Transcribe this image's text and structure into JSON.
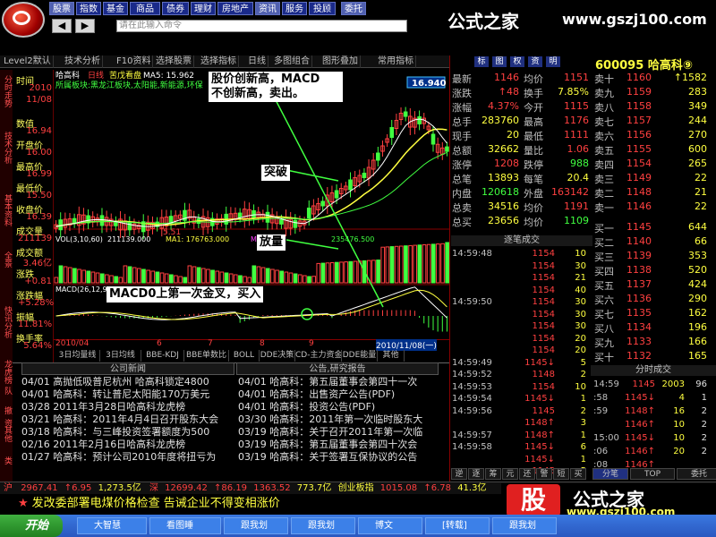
{
  "menu": [
    "股票",
    "指数",
    "基金",
    "商品",
    "债券",
    "理财",
    "房地产",
    "资讯",
    "服务",
    "投顾",
    "委托"
  ],
  "command_placeholder": "请在此输入命令",
  "brand": {
    "title": "公式之家",
    "url": "www.gszj100.com",
    "mark": "股"
  },
  "toolbar": [
    "Level2默认",
    "技术分析",
    "F10资料",
    "选择股票",
    "选择指标",
    "日线",
    "多图组合",
    "图形叠加",
    "常用指标"
  ],
  "chart_header": {
    "name": "哈高科",
    "period": "日线",
    "label": "苦戊看盘",
    "ma_text": "MA5: 15.962",
    "high_price": "16.940",
    "low_price": "5.51"
  },
  "chart_info": {
    "sub1": "所属板块:黑龙江板块,太阳能,新能源,环保",
    "vol_label": "VOL(3,10,60)",
    "vol_val": "211139.000",
    "vol_ma1": "MA1: 176763.000",
    "vol_ma2": "MA2",
    "vol_ma3": "235476.500",
    "macd_label": "MACD(26,12,9)"
  },
  "left_data": [
    {
      "label": "时间",
      "value": "2010"
    },
    {
      "label": "",
      "value": "11/08"
    },
    {
      "label": "数值",
      "value": "16.94"
    },
    {
      "label": "开盘价",
      "value": "16.00"
    },
    {
      "label": "最高价",
      "value": "16.99"
    },
    {
      "label": "最低价",
      "value": "15.50"
    },
    {
      "label": "收盘价",
      "value": "16.39"
    },
    {
      "label": "成交量",
      "value": "211139"
    },
    {
      "label": "成交额",
      "value": "3.46亿"
    },
    {
      "label": "涨跌",
      "value": "+0.81"
    },
    {
      "label": "涨跌幅",
      "value": "+5.28%"
    },
    {
      "label": "振幅",
      "value": "11.81%"
    },
    {
      "label": "换手率",
      "value": "5.64%"
    }
  ],
  "left_tabs": [
    "分时走势",
    "技术分析",
    "基本资料",
    "全景",
    "快讯分析",
    "龙虎榜",
    "队",
    "撤",
    "资",
    "其他",
    "类"
  ],
  "date_ticks": [
    "2010/04",
    "6",
    "7",
    "8",
    "9",
    "2010/11/08(一)"
  ],
  "bottom_tabs": [
    "3日均量线",
    "3日均线",
    "BBE-KDJ",
    "BBE单数比",
    "BOLL",
    "DDE决策",
    "CD-主力资金",
    "DDE能量",
    "其他"
  ],
  "annotations": [
    {
      "text": "股价创新高，MACD\n不创新高，卖出。"
    },
    {
      "text": "突破"
    },
    {
      "text": "放量"
    },
    {
      "text": "MACD0上第一次金叉，买入"
    }
  ],
  "news_left_title": "公司新闻",
  "news_right_title": "公告,研究报告",
  "news_left": [
    "04/01 高抛低吸普尼杭州 哈高科锁定4800",
    "04/01 哈高科：转让普尼太阳能170万美元",
    "03/28 2011年3月28日哈高科龙虎榜",
    "03/21 哈高科：2011年4月4日召开股东大会",
    "03/18 哈高科：与三峰投资签署额度为500",
    "02/16 2011年2月16日哈高科龙虎榜",
    "01/27 哈高科：预计公司2010年度将扭亏为"
  ],
  "news_right": [
    "04/01 哈高科：第五届董事会第四十一次",
    "04/01 哈高科：出售资产公告(PDF)",
    "04/01 哈高科：投资公告(PDF)",
    "03/30 哈高科：2011年第一次临时股东大",
    "03/19 哈高科：关于召开2011年第一次临",
    "03/19 哈高科：第五届董事会第四十次会",
    "03/19 哈高科：关于签署互保协议的公告"
  ],
  "quote_tabs": [
    "标",
    "图",
    "权",
    "资",
    "明"
  ],
  "stock": {
    "code": "600095",
    "name": "哈高科",
    "suffix": "⑨"
  },
  "quote_left": [
    {
      "label": "最新",
      "value": "1146",
      "color": "red",
      "label2": "均价",
      "value2": "1151",
      "color2": "red"
    },
    {
      "label": "涨跌",
      "value": "↑48",
      "color": "red",
      "label2": "换手",
      "value2": "7.85%",
      "color2": "yel"
    },
    {
      "label": "涨幅",
      "value": "4.37%",
      "color": "red",
      "label2": "今开",
      "value2": "1115",
      "color2": "red"
    },
    {
      "label": "总手",
      "value": "283760",
      "color": "yel",
      "label2": "最高",
      "value2": "1176",
      "color2": "red"
    },
    {
      "label": "现手",
      "value": "20",
      "color": "yel",
      "label2": "最低",
      "value2": "1111",
      "color2": "red"
    },
    {
      "label": "总额",
      "value": "32662",
      "color": "yel",
      "label2": "量比",
      "value2": "1.06",
      "color2": "red"
    },
    {
      "label": "涨停",
      "value": "1208",
      "color": "red",
      "label2": "跌停",
      "value2": "988",
      "color2": "grn"
    },
    {
      "label": "总笔",
      "value": "13893",
      "color": "yel",
      "label2": "每笔",
      "value2": "20.4",
      "color2": "yel"
    },
    {
      "label": "内盘",
      "value": "120618",
      "color": "grn",
      "label2": "外盘",
      "value2": "163142",
      "color2": "red"
    },
    {
      "label": "总卖",
      "value": "34516",
      "color": "yel",
      "label2": "均价",
      "value2": "1191",
      "color2": "red"
    },
    {
      "label": "总买",
      "value": "23656",
      "color": "yel",
      "label2": "均价",
      "value2": "1109",
      "color2": "grn"
    }
  ],
  "sell_orders": [
    {
      "label": "卖十",
      "price": "1160",
      "vol": "↑1582"
    },
    {
      "label": "卖九",
      "price": "1159",
      "vol": "283"
    },
    {
      "label": "卖八",
      "price": "1158",
      "vol": "349"
    },
    {
      "label": "卖七",
      "price": "1157",
      "vol": "244"
    },
    {
      "label": "卖六",
      "price": "1156",
      "vol": "270"
    },
    {
      "label": "卖五",
      "price": "1155",
      "vol": "600"
    },
    {
      "label": "卖四",
      "price": "1154",
      "vol": "265"
    },
    {
      "label": "卖三",
      "price": "1149",
      "vol": "22"
    },
    {
      "label": "卖二",
      "price": "1148",
      "vol": "21"
    },
    {
      "label": "卖一",
      "price": "1146",
      "vol": "22"
    }
  ],
  "buy_orders": [
    {
      "label": "买一",
      "price": "1145",
      "vol": "644"
    },
    {
      "label": "买二",
      "price": "1140",
      "vol": "66"
    },
    {
      "label": "买三",
      "price": "1139",
      "vol": "353"
    },
    {
      "label": "买四",
      "price": "1138",
      "vol": "520"
    },
    {
      "label": "买五",
      "price": "1137",
      "vol": "424"
    },
    {
      "label": "买六",
      "price": "1136",
      "vol": "290"
    },
    {
      "label": "买七",
      "price": "1135",
      "vol": "162"
    },
    {
      "label": "买八",
      "price": "1134",
      "vol": "196"
    },
    {
      "label": "买九",
      "price": "1133",
      "vol": "166"
    },
    {
      "label": "买十",
      "price": "1132",
      "vol": "165"
    }
  ],
  "ticks_title": "逐笔成交",
  "ticks": [
    {
      "time": "14:59:48",
      "price": "1154",
      "vol": "10"
    },
    {
      "time": "",
      "price": "1154",
      "vol": "30"
    },
    {
      "time": "",
      "price": "1154",
      "vol": "21"
    },
    {
      "time": "",
      "price": "1154",
      "vol": "40"
    },
    {
      "time": "14:59:50",
      "price": "1154",
      "vol": "30"
    },
    {
      "time": "",
      "price": "1154",
      "vol": "30"
    },
    {
      "time": "",
      "price": "1154",
      "vol": "30"
    },
    {
      "time": "",
      "price": "1154",
      "vol": "20"
    },
    {
      "time": "",
      "price": "1154",
      "vol": "20"
    },
    {
      "time": "14:59:49",
      "price": "1145↓",
      "vol": "5"
    },
    {
      "time": "14:59:52",
      "price": "1148",
      "vol": "2"
    },
    {
      "time": "14:59:53",
      "price": "1154",
      "vol": "10"
    },
    {
      "time": "14:59:54",
      "price": "1145↓",
      "vol": "1"
    },
    {
      "time": "14:59:56",
      "price": "1145",
      "vol": "2"
    },
    {
      "time": "",
      "price": "1148↑",
      "vol": "3"
    },
    {
      "time": "14:59:57",
      "price": "1148↑",
      "vol": "1"
    },
    {
      "time": "14:59:58",
      "price": "1145↓",
      "vol": "6"
    },
    {
      "time": "",
      "price": "1145↓",
      "vol": "1"
    },
    {
      "time": "",
      "price": "1145",
      "vol": "5"
    }
  ],
  "fenshi_title": "分时成交",
  "fenshi": [
    {
      "time": "14:59",
      "price": "1145",
      "vol": "2003",
      "n": "96"
    },
    {
      "time": ":58",
      "price": "1145↓",
      "vol": "4",
      "n": "1"
    },
    {
      "time": ":59",
      "price": "1148↑",
      "vol": "16",
      "n": "2"
    },
    {
      "time": "",
      "price": "1146↑",
      "vol": "10",
      "n": "2"
    },
    {
      "time": "15:00",
      "price": "1145↓",
      "vol": "10",
      "n": "2"
    },
    {
      "time": ":06",
      "price": "1146↑",
      "vol": "20",
      "n": "2"
    },
    {
      "time": ":08",
      "price": "1146↑",
      "vol": "",
      "n": ""
    }
  ],
  "right_bottom_tabs": [
    "逆",
    "逐",
    "筹",
    "元",
    "还",
    "警",
    "短",
    "买"
  ],
  "right_bottom_tabs2": [
    "分笔",
    "TOP",
    "委托"
  ],
  "status_bar": {
    "a": "沪",
    "b": "2967.41",
    "c": "↑6.95",
    "d": "1,273.5亿",
    "e": "深",
    "f": "12699.42",
    "g": "↑86.19",
    "h": "1363.52",
    "i": "773.7亿",
    "j": "创业板指",
    "k": "1015.08",
    "l": "↑6.78",
    "m": "41.3亿"
  },
  "ticker": "发改委部署电煤价格检查 告诫企业不得变相涨价",
  "taskbar": {
    "start": "开始",
    "tasks": [
      "大智慧",
      "看图睡",
      "跟我划",
      "跟我划",
      "博文",
      "[转载]",
      "跟我划"
    ]
  }
}
